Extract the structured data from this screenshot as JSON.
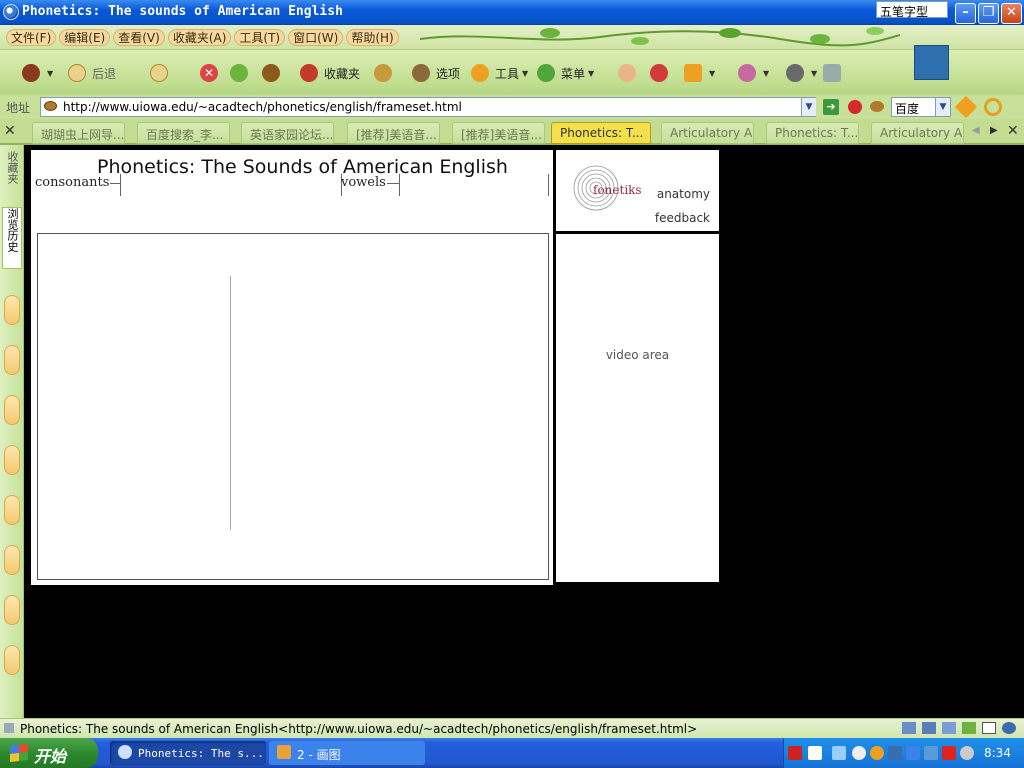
{
  "window": {
    "title": "Phonetics: The sounds of American English",
    "ime_label": "五笔字型",
    "controls": [
      "_",
      "❐",
      "✕"
    ]
  },
  "menubar": {
    "items": [
      {
        "label": "文件(F)"
      },
      {
        "label": "编辑(E)"
      },
      {
        "label": "查看(V)"
      },
      {
        "label": "收藏夹(A)"
      },
      {
        "label": "工具(T)"
      },
      {
        "label": "窗口(W)"
      },
      {
        "label": "帮助(H)"
      }
    ]
  },
  "toolbar": {
    "back_label": "后退",
    "favorites_label": "收藏夹",
    "options_label": "选项",
    "tools_label": "工具",
    "menu_label": "菜单"
  },
  "addressbar": {
    "label": "地址",
    "url": "http://www.uiowa.edu/~acadtech/phonetics/english/frameset.html",
    "search_engine": "百度"
  },
  "tabs": [
    {
      "label": "瑚瑚虫上网导..."
    },
    {
      "label": "百度搜索_李..."
    },
    {
      "label": "英语家园论坛..."
    },
    {
      "label": "[推荐]美语音..."
    },
    {
      "label": "[推荐]美语音..."
    },
    {
      "label": "Phonetics: T..."
    },
    {
      "label": "Articulatory A..."
    },
    {
      "label": "Phonetics: T..."
    },
    {
      "label": "Articulatory A..."
    }
  ],
  "sidebar": {
    "favorites_label": "收藏夹",
    "history_label": "浏览历史"
  },
  "page": {
    "title": "Phonetics:  The Sounds of American English",
    "consonants_label": "consonants",
    "vowels_label": "vowels",
    "logo_text": "fonetiks",
    "anatomy_label": "anatomy",
    "feedback_label": "feedback",
    "video_label": "video area"
  },
  "statusbar": {
    "text": "Phonetics: The sounds of American English<http://www.uiowa.edu/~acadtech/phonetics/english/frameset.html>"
  },
  "taskbar": {
    "start_label": "开始",
    "items": [
      {
        "label": "Phonetics: The s..."
      },
      {
        "label": "2 - 画图"
      }
    ],
    "clock": "8:34"
  },
  "colors": {
    "accent_green": "#c6e197",
    "active_tab": "#f3e04b",
    "logo_red": "#8d2a3b"
  }
}
